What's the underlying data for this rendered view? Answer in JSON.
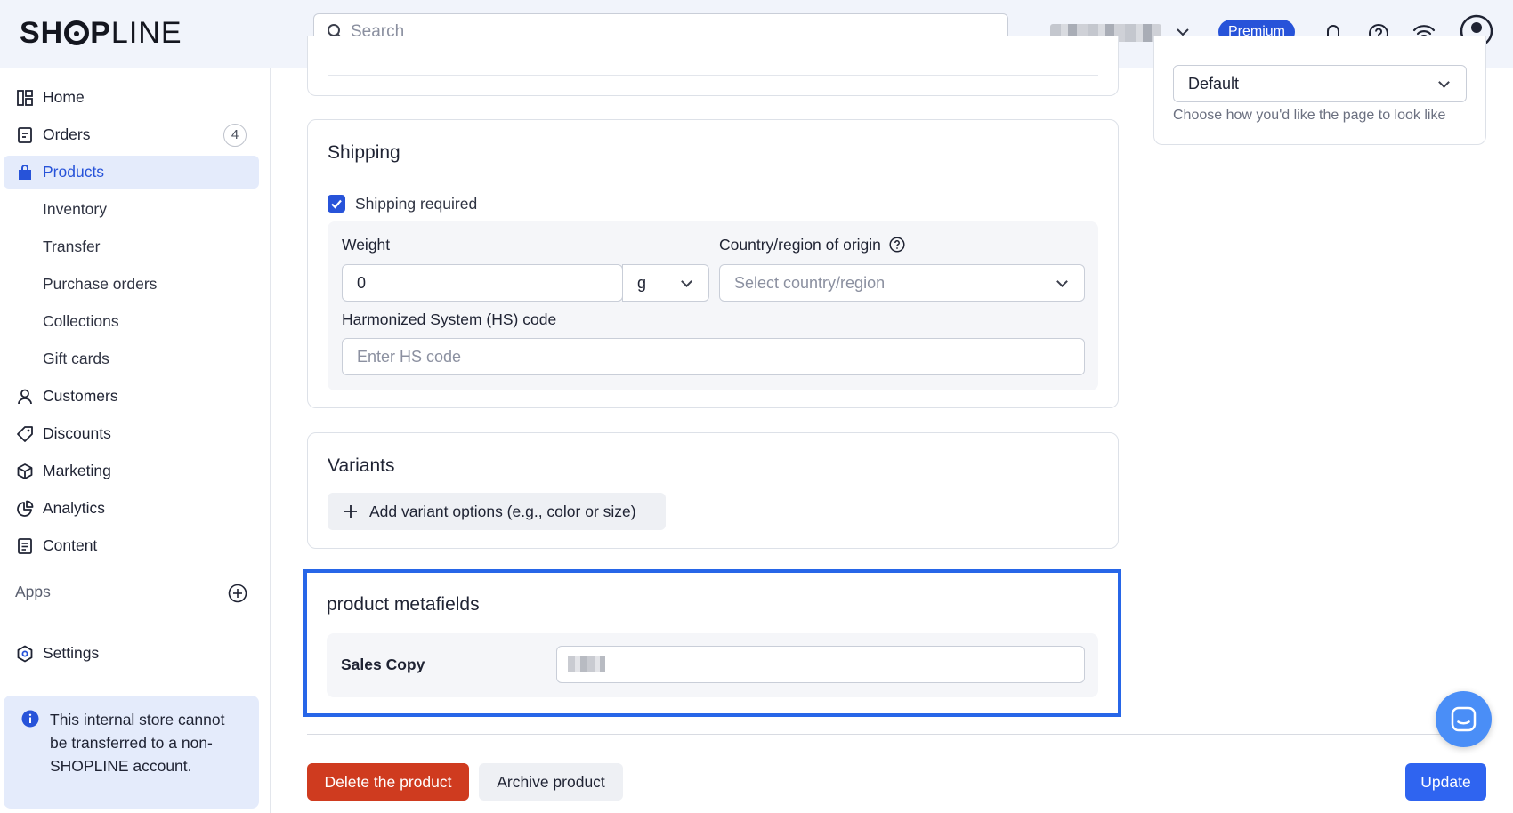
{
  "header": {
    "logo_main": "SH",
    "logo_after_ring": "P",
    "logo_light": "LINE",
    "search_placeholder": "Search",
    "plan_badge": "Premium"
  },
  "sidebar": {
    "items": [
      {
        "label": "Home",
        "icon": "home-icon"
      },
      {
        "label": "Orders",
        "icon": "orders-icon",
        "badge": "4"
      },
      {
        "label": "Products",
        "icon": "products-icon",
        "active": true
      },
      {
        "label": "Inventory"
      },
      {
        "label": "Transfer"
      },
      {
        "label": "Purchase orders"
      },
      {
        "label": "Collections"
      },
      {
        "label": "Gift cards"
      },
      {
        "label": "Customers",
        "icon": "customers-icon"
      },
      {
        "label": "Discounts",
        "icon": "discounts-icon"
      },
      {
        "label": "Marketing",
        "icon": "marketing-icon"
      },
      {
        "label": "Analytics",
        "icon": "analytics-icon"
      },
      {
        "label": "Content",
        "icon": "content-icon"
      }
    ],
    "apps_label": "Apps",
    "settings_label": "Settings",
    "notice": "This internal store cannot be transferred to a non-SHOPLINE account."
  },
  "template_panel": {
    "select_value": "Default",
    "help": "Choose how you'd like the page to look like"
  },
  "shipping": {
    "title": "Shipping",
    "checkbox_label": "Shipping required",
    "checkbox_checked": true,
    "weight_label": "Weight",
    "weight_value": "0",
    "weight_unit": "g",
    "origin_label": "Country/region of origin",
    "origin_placeholder": "Select country/region",
    "hs_label": "Harmonized System (HS) code",
    "hs_placeholder": "Enter HS code"
  },
  "variants": {
    "title": "Variants",
    "add_button": "Add variant options (e.g., color or size)"
  },
  "metafields": {
    "title": "product metafields",
    "field_label": "Sales Copy"
  },
  "footer": {
    "delete_button": "Delete the product",
    "archive_button": "Archive product",
    "update_button": "Update"
  },
  "colors": {
    "accent": "#2753d9",
    "danger": "#cf3b1f",
    "highlight": "#2766e8"
  }
}
